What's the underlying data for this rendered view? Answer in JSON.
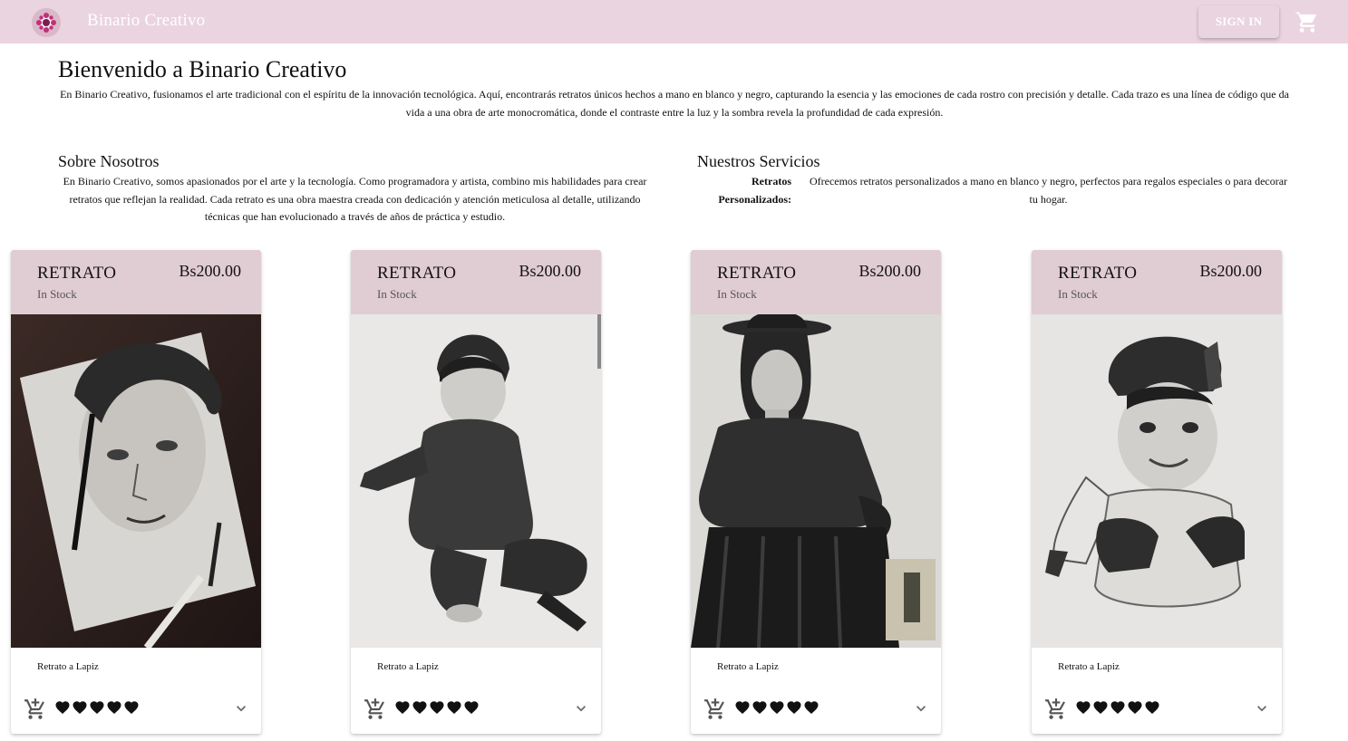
{
  "header": {
    "app_title": "Binario Creativo",
    "signin_label": "SIGN IN",
    "logo_icon": "flower-logo-icon",
    "cart_icon": "shopping-cart-icon",
    "bg_color": "#ead4df"
  },
  "intro": {
    "title": "Bienvenido a Binario Creativo",
    "text": "En Binario Creativo, fusionamos el arte tradicional con el espíritu de la innovación tecnológica. Aquí, encontrarás retratos únicos hechos a mano en blanco y negro, capturando la esencia y las emociones de cada rostro con precisión y detalle. Cada trazo es una línea de código que da vida a una obra de arte monocromática, donde el contraste entre la luz y la sombra revela la profundidad de cada expresión."
  },
  "about": {
    "title": "Sobre Nosotros",
    "text": "En Binario Creativo, somos apasionados por el arte y la tecnología. Como programadora y artista, combino mis habilidades para crear retratos que reflejan la realidad. Cada retrato es una obra maestra creada con dedicación y atención meticulosa al detalle, utilizando técnicas que han evolucionado a través de años de práctica y estudio."
  },
  "services": {
    "title": "Nuestros Servicios",
    "items": [
      {
        "name": "Retratos Personalizados:",
        "description": "Ofrecemos retratos personalizados a mano en blanco y negro, perfectos para regalos especiales o para decorar tu hogar."
      }
    ]
  },
  "products": [
    {
      "title": "RETRATO",
      "stock": "In Stock",
      "price": "Bs200.00",
      "description": "Retrato a Lapiz",
      "image": "portrait-young-man-curly-hair",
      "rating": 5
    },
    {
      "title": "RETRATO",
      "stock": "In Stock",
      "price": "Bs200.00",
      "description": "Retrato a Lapiz",
      "image": "portrait-sitting-child",
      "rating": 5
    },
    {
      "title": "RETRATO",
      "stock": "In Stock",
      "price": "Bs200.00",
      "description": "Retrato a Lapiz",
      "image": "portrait-woman-bowler-hat",
      "rating": 5
    },
    {
      "title": "RETRATO",
      "stock": "In Stock",
      "price": "Bs200.00",
      "description": "Retrato a Lapiz",
      "image": "portrait-baby-cap",
      "rating": 5
    }
  ],
  "card_header_color": "#e0ccd3"
}
